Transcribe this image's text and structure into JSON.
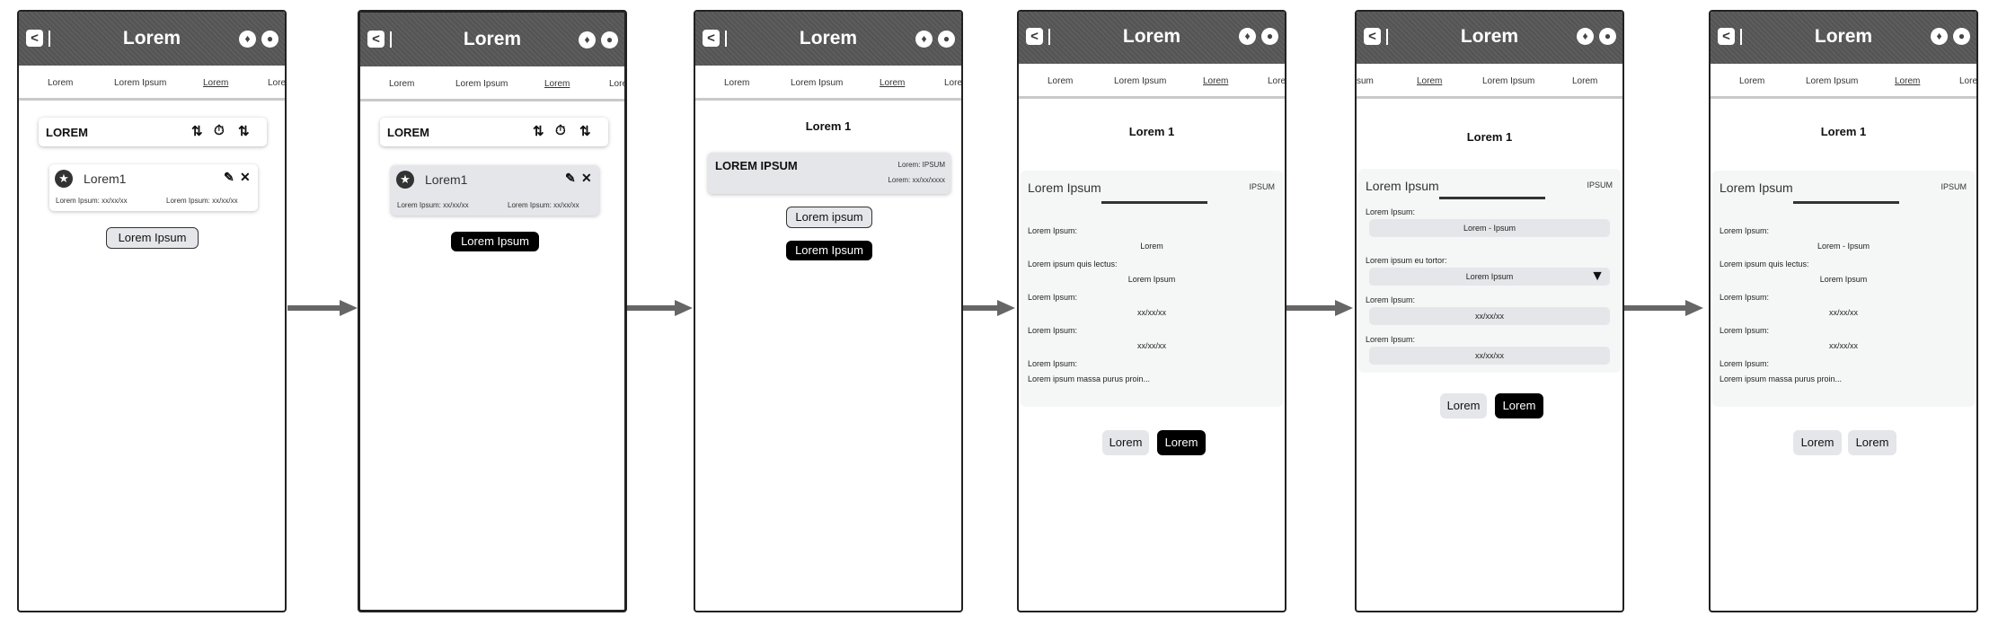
{
  "header": {
    "title": "Lorem",
    "back_glyph": "<",
    "bell_icon": "bell-icon",
    "user_icon": "user-icon"
  },
  "tabs_a": [
    "Lorem",
    "Lorem Ipsum",
    "Lorem",
    "Lore"
  ],
  "tabs_b": [
    "sum",
    "Lorem",
    "Lorem Ipsum",
    "Lorem"
  ],
  "screen1": {
    "sort_label": "LOREM",
    "sort_icons": [
      "sort-numeric-icon",
      "timer-icon",
      "sort-numeric-reverse-icon"
    ],
    "card_name": "Lorem1",
    "card_meta_left": "Lorem Ipsum: xx/xx/xx",
    "card_meta_right": "Lorem Ipsum: xx/xx/xx",
    "button": "Lorem Ipsum"
  },
  "screen2": {
    "sort_label": "LOREM",
    "card_name": "Lorem1",
    "card_meta_left": "Lorem Ipsum: xx/xx/xx",
    "card_meta_right": "Lorem Ipsum: xx/xx/xx",
    "button": "Lorem Ipsum"
  },
  "screen3": {
    "heading": "Lorem 1",
    "card_title": "LOREM IPSUM",
    "card_r1": "Lorem: IPSUM",
    "card_r2": "Lorem:  xx/xx/xxxx",
    "button_outline": "Lorem ipsum",
    "button_black": "Lorem Ipsum"
  },
  "screen4": {
    "heading": "Lorem 1",
    "panel_title": "Lorem Ipsum",
    "panel_tag": "IPSUM",
    "labels": [
      "Lorem Ipsum:",
      "Lorem ipsum quis lectus:",
      "Lorem Ipsum:",
      "Lorem Ipsum:",
      "Lorem Ipsum:"
    ],
    "values": [
      "Lorem",
      "Lorem Ipsum",
      "xx/xx/xx",
      "xx/xx/xx",
      "Lorem ipsum massa purus proin..."
    ],
    "btn_left": "Lorem",
    "btn_right": "Lorem"
  },
  "screen5": {
    "heading": "Lorem 1",
    "panel_title": "Lorem Ipsum",
    "panel_tag": "IPSUM",
    "labels": [
      "Lorem Ipsum:",
      "Lorem ipsum eu tortor:",
      "Lorem Ipsum:",
      "Lorem Ipsum:"
    ],
    "fields": [
      "Lorem - Ipsum",
      "Lorem Ipsum",
      "xx/xx/xx",
      "xx/xx/xx"
    ],
    "dropdown_icon": "triangle-down-icon",
    "btn_left": "Lorem",
    "btn_right": "Lorem"
  },
  "screen6": {
    "heading": "Lorem 1",
    "panel_title": "Lorem Ipsum",
    "panel_tag": "IPSUM",
    "labels": [
      "Lorem Ipsum:",
      "Lorem ipsum quis lectus:",
      "Lorem Ipsum:",
      "Lorem Ipsum:",
      "Lorem Ipsum:"
    ],
    "values": [
      "Lorem - Ipsum",
      "Lorem Ipsum",
      "xx/xx/xx",
      "xx/xx/xx",
      "Lorem ipsum massa purus proin..."
    ],
    "btn_left": "Lorem",
    "btn_right": "Lorem"
  },
  "colors": {
    "header": "#575757",
    "panel": "#f5f6f6",
    "field": "#e4e6e9",
    "arrow": "#666666"
  }
}
